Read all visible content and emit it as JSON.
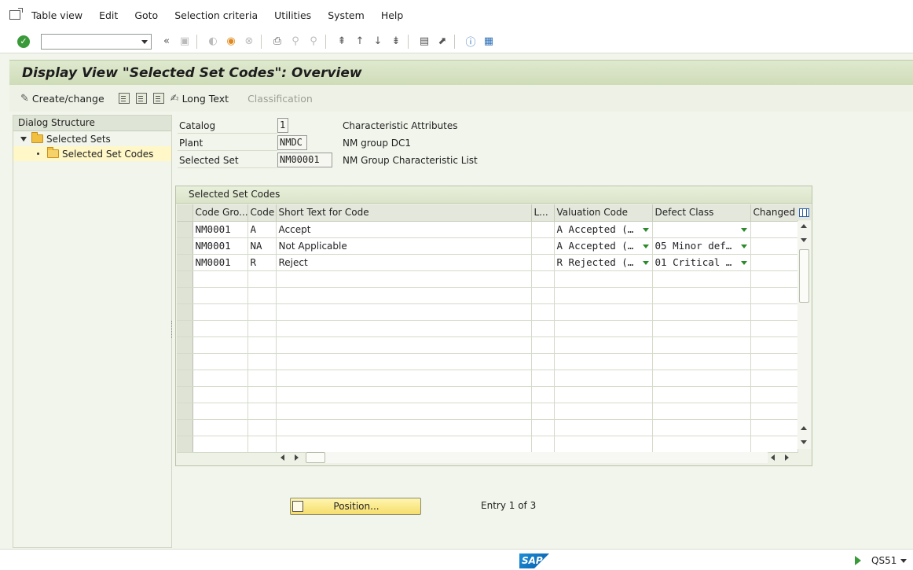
{
  "menu": {
    "items": [
      "Table view",
      "Edit",
      "Goto",
      "Selection criteria",
      "Utilities",
      "System",
      "Help"
    ]
  },
  "toolbar": {
    "command_value": "",
    "icons": [
      "check-icon",
      "back-double-icon",
      "save-icon",
      "back-icon",
      "exit-icon",
      "cancel-icon",
      "print-icon",
      "find-icon",
      "find-next-icon",
      "first-page-icon",
      "prev-page-icon",
      "next-page-icon",
      "last-page-icon",
      "new-session-icon",
      "shortcut-icon",
      "help-icon",
      "layout-icon"
    ]
  },
  "title": "Display View \"Selected Set Codes\": Overview",
  "app_toolbar": {
    "create_change": "Create/change",
    "long_text": "Long Text",
    "classification": "Classification"
  },
  "dialog_structure": {
    "header": "Dialog Structure",
    "items": [
      "Selected Sets",
      "Selected Set Codes"
    ]
  },
  "header_fields": [
    {
      "label": "Catalog",
      "value": "1",
      "desc": "Characteristic Attributes"
    },
    {
      "label": "Plant",
      "value": "NMDC",
      "desc": "NM group DC1"
    },
    {
      "label": "Selected Set",
      "value": "NM00001",
      "desc": "NM Group Characteristic List"
    }
  ],
  "table": {
    "caption": "Selected Set Codes",
    "columns": [
      "Code Gro...",
      "Code",
      "Short Text for Code",
      "L...",
      "Valuation Code",
      "Defect Class",
      "Changed B"
    ],
    "rows": [
      {
        "code_group": "NM0001",
        "code": "A",
        "short_text": "Accept",
        "l": "",
        "valuation": "A Accepted (…",
        "defect": "",
        "changed": ""
      },
      {
        "code_group": "NM0001",
        "code": "NA",
        "short_text": "Not Applicable",
        "l": "",
        "valuation": "A Accepted (…",
        "defect": "05 Minor def…",
        "changed": ""
      },
      {
        "code_group": "NM0001",
        "code": "R",
        "short_text": "Reject",
        "l": "",
        "valuation": "R Rejected (…",
        "defect": "01 Critical …",
        "changed": ""
      }
    ]
  },
  "position_button": "Position...",
  "entry_text": "Entry 1 of 3",
  "status": {
    "logo": "SAP",
    "system": "QS51"
  }
}
